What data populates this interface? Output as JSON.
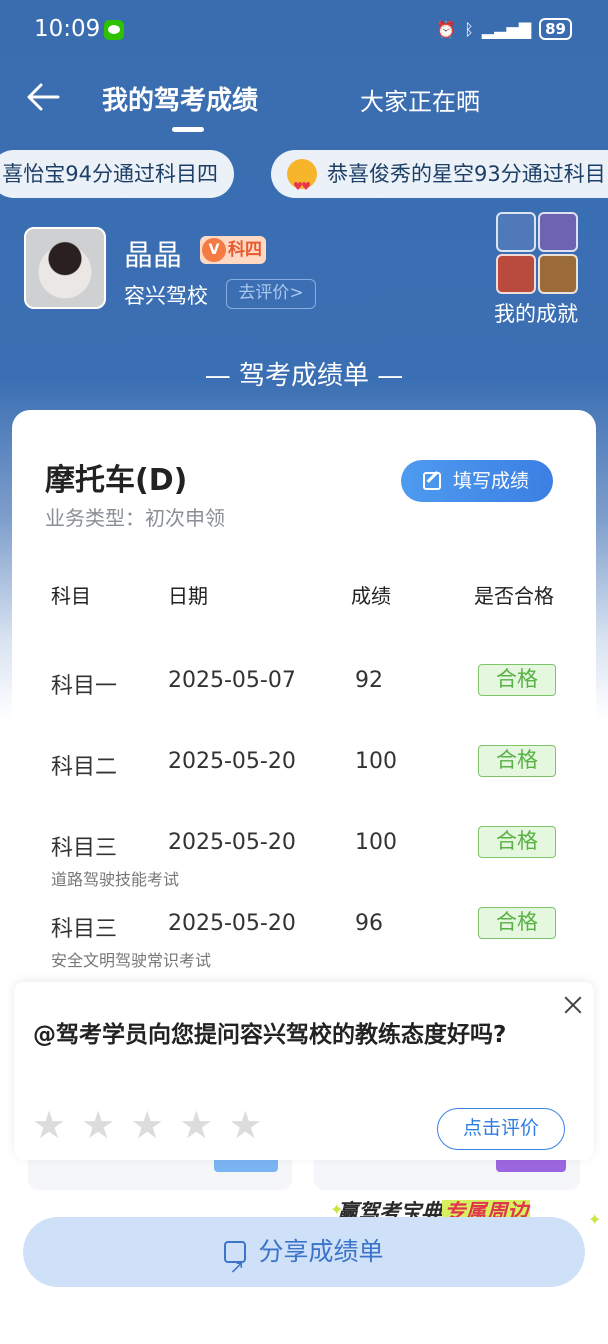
{
  "status_bar": {
    "time": "10:09",
    "battery": "89"
  },
  "nav": {
    "active_tab": "我的驾考成绩",
    "other_tab": "大家正在晒"
  },
  "ticker": [
    "喜怡宝94分通过科目四",
    "恭喜俊秀的星空93分通过科目"
  ],
  "profile": {
    "name": "晶晶",
    "badge": "科四",
    "badge_v": "V",
    "school": "容兴驾校",
    "rate_link": "去评价>",
    "achievements": "我的成就"
  },
  "sheet_title": "— 驾考成绩单 —",
  "card": {
    "vehicle": "摩托车(D)",
    "business_type": "业务类型：初次申领",
    "fill_button": "填写成绩",
    "headers": [
      "科目",
      "日期",
      "成绩",
      "是否合格"
    ],
    "rows": [
      {
        "subject": "科目一",
        "date": "2025-05-07",
        "score": "92",
        "result": "合格",
        "note": ""
      },
      {
        "subject": "科目二",
        "date": "2025-05-20",
        "score": "100",
        "result": "合格",
        "note": ""
      },
      {
        "subject": "科目三",
        "date": "2025-05-20",
        "score": "100",
        "result": "合格",
        "note": "道路驾驶技能考试"
      },
      {
        "subject": "科目三",
        "date": "2025-05-20",
        "score": "96",
        "result": "合格",
        "note": "安全文明驾驶常识考试"
      }
    ]
  },
  "popup": {
    "question": "@驾考学员向您提问容兴驾校的教练态度好吗?",
    "rating_stars": 0,
    "rate_button": "点击评价"
  },
  "promo": {
    "text1": "赢驾考宝典",
    "text2": "专属周边"
  },
  "share_button": "分享成绩单",
  "colors": {
    "primary_blue": "#3b6fb3",
    "pass_green": "#58b244",
    "button_blue": "#3b7fe3"
  }
}
